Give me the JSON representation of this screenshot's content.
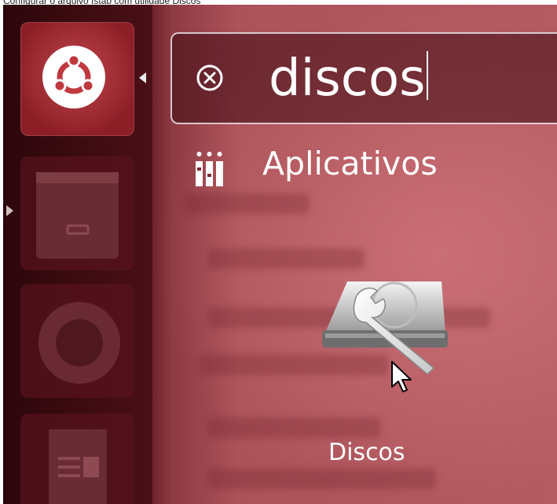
{
  "caption": "Configurar o arquivo fstab com utilidade Discos",
  "launcher": {
    "items": [
      {
        "name": "ubuntu-dash-button",
        "icon": "ubuntu-logo-icon"
      },
      {
        "name": "files-button",
        "icon": "file-cabinet-icon"
      },
      {
        "name": "firefox-button",
        "icon": "firefox-icon"
      },
      {
        "name": "writer-button",
        "icon": "document-icon"
      }
    ]
  },
  "search": {
    "query": "discos",
    "clear_icon": "clear-icon"
  },
  "category": {
    "label": "Aplicativos",
    "icon": "applications-icon"
  },
  "result": {
    "label": "Discos",
    "icon": "disk-utility-icon"
  },
  "colors": {
    "accent": "#8c1e26",
    "overlay": "#c46a70"
  }
}
